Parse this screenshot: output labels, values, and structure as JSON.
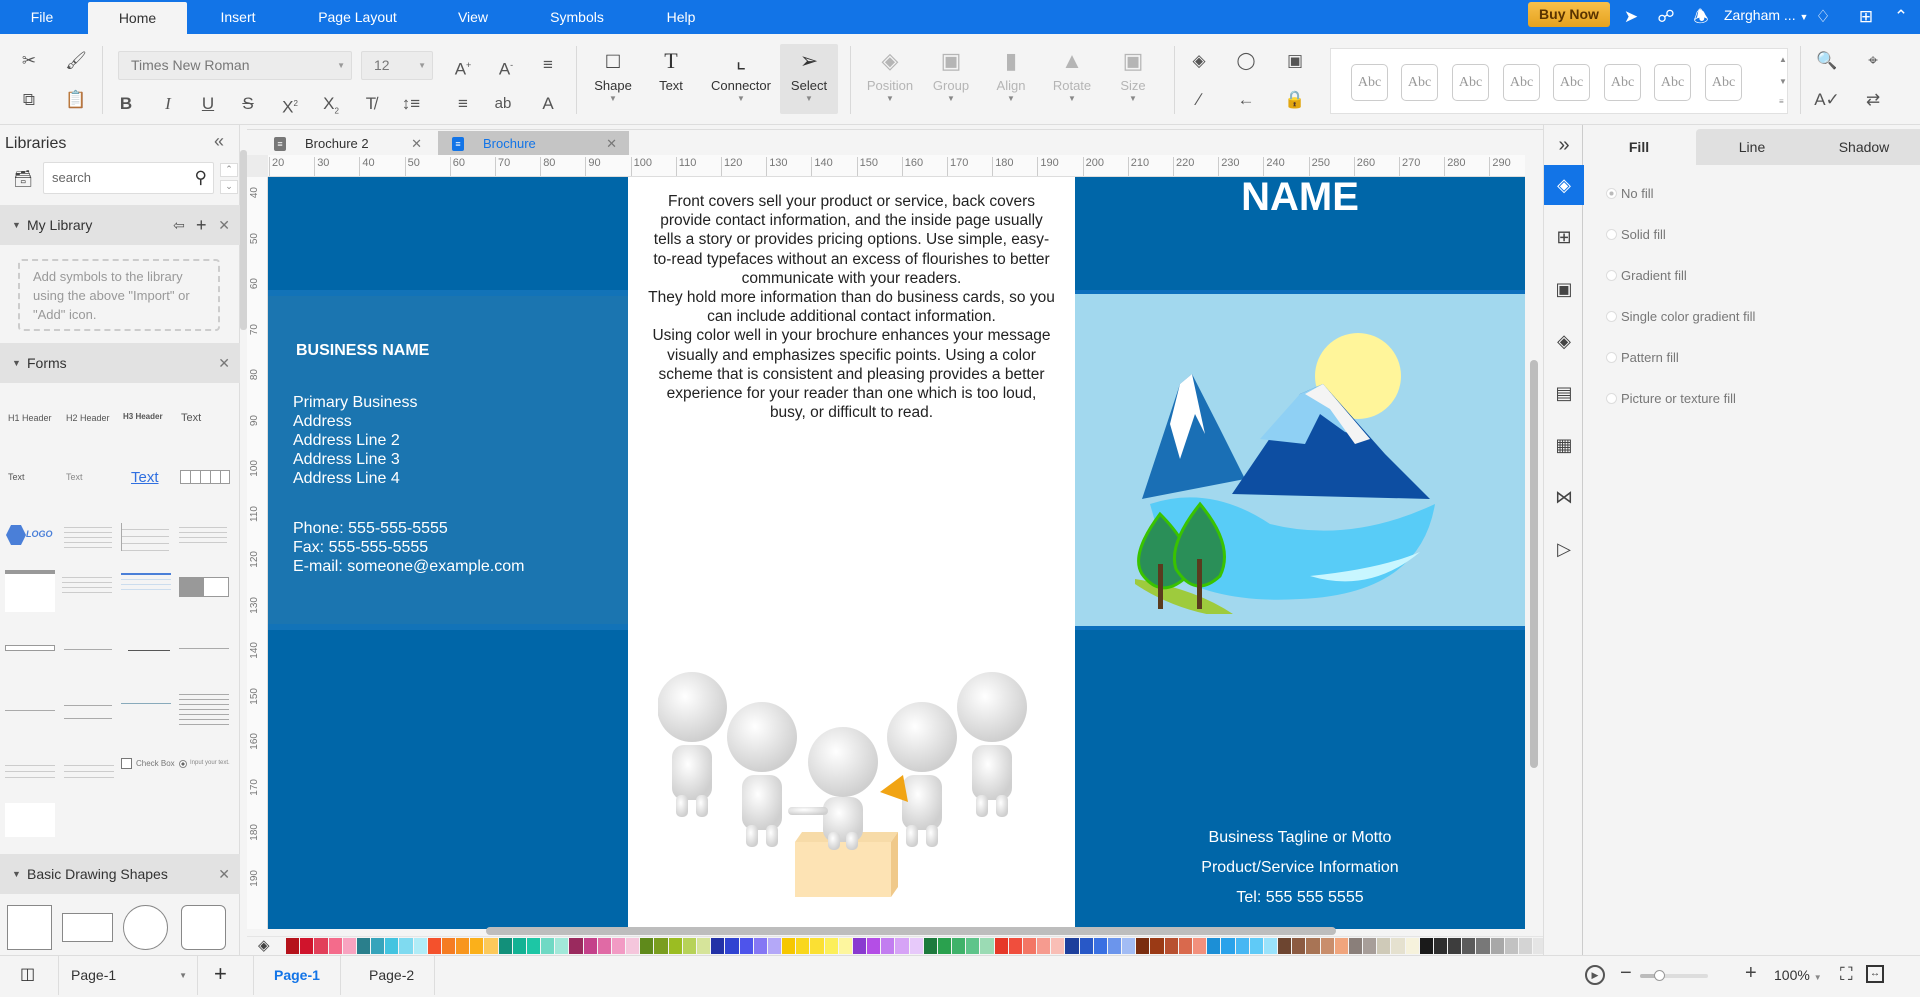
{
  "menubar": {
    "items": [
      "File",
      "Home",
      "Insert",
      "Page Layout",
      "View",
      "Symbols",
      "Help"
    ],
    "active": "Home",
    "buy_now": "Buy Now",
    "user_name": "Zargham ...",
    "accent": "#1274e7"
  },
  "toolbar": {
    "font_family": "Times New Roman",
    "font_size": "12",
    "shape_label": "Shape",
    "text_label": "Text",
    "connector_label": "Connector",
    "select_label": "Select",
    "position_label": "Position",
    "group_label": "Group",
    "align_label": "Align",
    "rotate_label": "Rotate",
    "size_label": "Size",
    "style_presets": [
      "Abc",
      "Abc",
      "Abc",
      "Abc",
      "Abc",
      "Abc",
      "Abc",
      "Abc"
    ]
  },
  "sidebar": {
    "title": "Libraries",
    "search_placeholder": "search",
    "my_library": {
      "title": "My Library",
      "empty_text": "Add symbols to the library using the above \"Import\" or \"Add\" icon."
    },
    "forms": {
      "title": "Forms",
      "thumbs": [
        "H1 Header",
        "H2 Header",
        "H3 Header",
        "Text",
        "Text",
        "Text",
        "Text",
        "LOGO",
        "Check Box",
        "Input your text."
      ]
    },
    "basic_shapes": {
      "title": "Basic Drawing Shapes"
    }
  },
  "doc_tabs": [
    {
      "label": "Brochure 2",
      "active": false
    },
    {
      "label": "Brochure",
      "active": true
    }
  ],
  "rulers": {
    "horizontal": [
      "20",
      "30",
      "40",
      "50",
      "60",
      "70",
      "80",
      "90",
      "100",
      "110",
      "120",
      "130",
      "140",
      "150",
      "160",
      "170",
      "180",
      "190",
      "200",
      "210",
      "220",
      "230",
      "240",
      "250",
      "260",
      "270",
      "280",
      "290"
    ],
    "vertical": [
      "40",
      "50",
      "60",
      "70",
      "80",
      "90",
      "100",
      "110",
      "120",
      "130",
      "140",
      "150",
      "160",
      "170",
      "180",
      "190"
    ]
  },
  "brochure": {
    "business_name": "BUSINESS NAME",
    "address_lines": [
      "Primary Business",
      "Address",
      "Address Line 2",
      "Address Line 3",
      "Address Line 4"
    ],
    "contact_lines": [
      "Phone: 555-555-5555",
      "Fax: 555-555-5555",
      "E-mail: someone@example.com"
    ],
    "middle_text": "Front covers sell your product or service, back covers provide contact information, and the inside page usually tells a story or provides pricing options. Use simple, easy-to-read typefaces without an excess of flourishes to better communicate with your readers.\nThey hold more information than do business cards, so you can include additional contact information.\nUsing color well in your brochure enhances your message visually and emphasizes specific points. Using a color scheme that is consistent and pleasing provides a better experience for your reader than one which is too loud, busy, or difficult to read.",
    "cover_title": "NAME",
    "tagline": "Business Tagline or Motto",
    "product_info": "Product/Service Information",
    "tel": "Tel: 555 555 5555",
    "colors": {
      "dark_blue": "#0066a8",
      "mid_blue": "#1b75b0",
      "light_blue": "#a2d8ee"
    }
  },
  "palette": [
    "#b5121b",
    "#d0142c",
    "#e2405a",
    "#f46b8b",
    "#f8a3c0",
    "#2a7f8c",
    "#36a4bb",
    "#43c4e0",
    "#7fdaf0",
    "#b0ecf7",
    "#f4512c",
    "#f57c22",
    "#f8961e",
    "#fbb01a",
    "#fcc95a",
    "#12907a",
    "#13b294",
    "#1dc6a5",
    "#6fd9c4",
    "#a2e8d9",
    "#9a2a5e",
    "#c4418a",
    "#e06aa5",
    "#f29bc4",
    "#f5c6dc",
    "#5f8a1b",
    "#7a9e1f",
    "#9bbd22",
    "#b7d258",
    "#d6e49a",
    "#2231a7",
    "#3043d1",
    "#4e54eb",
    "#8577f4",
    "#b4a8f8",
    "#f6c700",
    "#f9d71c",
    "#fbe033",
    "#fcef5a",
    "#fdf69e",
    "#8a3ad0",
    "#b44ee6",
    "#c27df0",
    "#d6a3f6",
    "#e7c9fa",
    "#1d7a3d",
    "#2aa14e",
    "#3fb26a",
    "#5ec48a",
    "#9bdbb4",
    "#e63828",
    "#f04e3d",
    "#f37665",
    "#f69b8f",
    "#f9beb6",
    "#1d3f9c",
    "#2858c7",
    "#3a70e2",
    "#6b95ec",
    "#a2bcf4",
    "#7a2d0f",
    "#9b3a15",
    "#b85030",
    "#d9694d",
    "#f2907c",
    "#1c8fd6",
    "#2aa2ea",
    "#47b7f3",
    "#5fcaf7",
    "#9ae2fb",
    "#6d4530",
    "#8c5b42",
    "#a87455",
    "#c98e6c",
    "#f0a57d",
    "#8a7f7a",
    "#a79e99",
    "#cfcab8",
    "#e5e1cf",
    "#f6f2dc",
    "#1a1a1a",
    "#2e2e2e",
    "#3d3d3d",
    "#5b5b5b",
    "#787878",
    "#a8a8a8",
    "#c2c2c2",
    "#d4d4d4",
    "#e5e5e5",
    "#f2f2f2",
    "#ffffff"
  ],
  "right_panel": {
    "tabs": [
      "Fill",
      "Line",
      "Shadow"
    ],
    "active_tab": "Fill",
    "options": [
      "No fill",
      "Solid fill",
      "Gradient fill",
      "Single color gradient fill",
      "Pattern fill",
      "Picture or texture fill"
    ],
    "selected_option": "No fill"
  },
  "statusbar": {
    "page_select": "Page-1",
    "pages": [
      "Page-1",
      "Page-2"
    ],
    "active_page": "Page-1",
    "zoom": "100%",
    "zoom_fraction": 0.28
  }
}
